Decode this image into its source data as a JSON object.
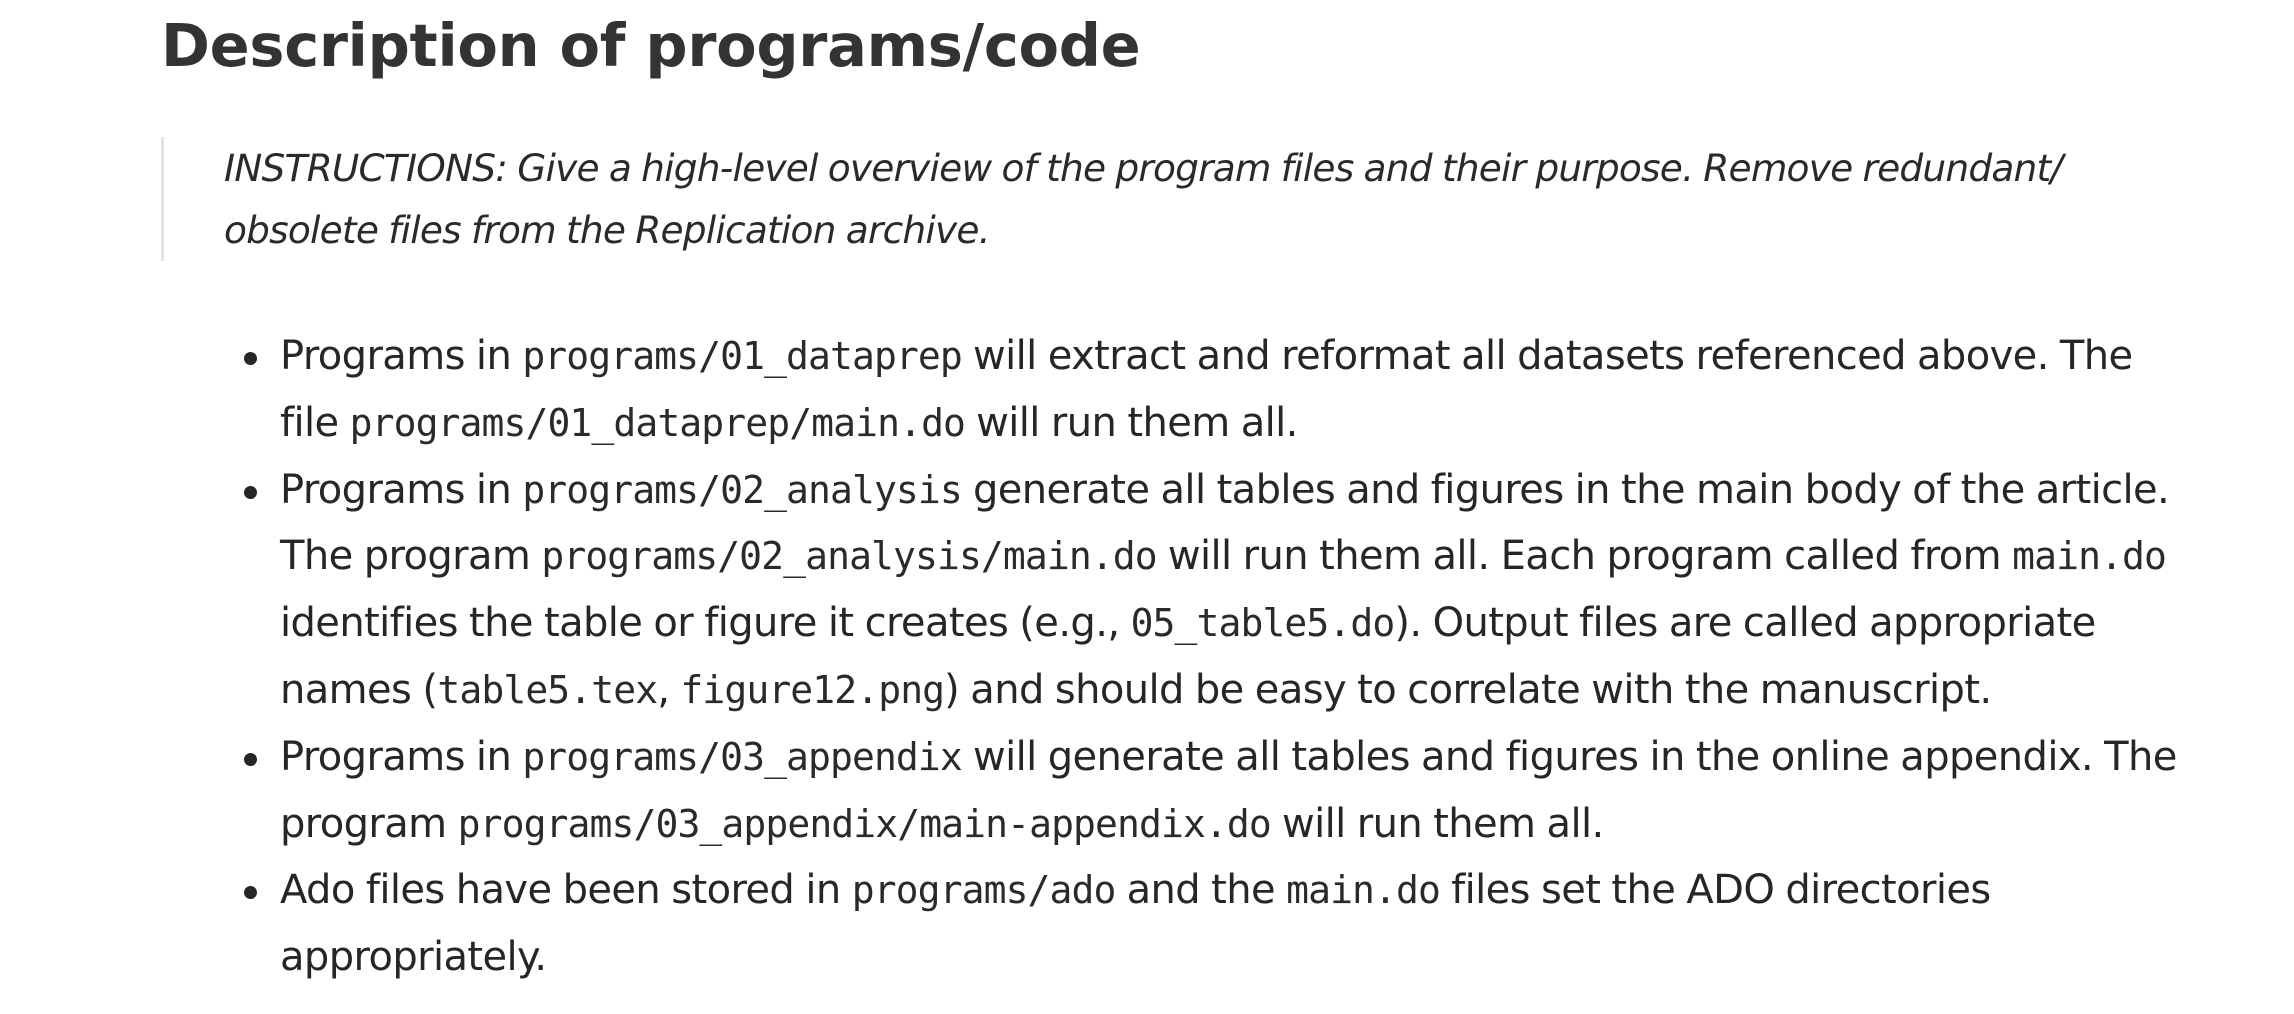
{
  "section": {
    "heading": "Description of programs/code",
    "instructions": "INSTRUCTIONS: Give a high-level overview of the program files and their purpose. Remove redundant/ obsolete files from the Replication archive."
  },
  "items": [
    {
      "t1": "Programs in ",
      "c1": "programs/01_dataprep",
      "t2": " will extract and reformat all datasets referenced above. The file ",
      "c2": "programs/01_dataprep/main.do",
      "t3": " will run them all."
    },
    {
      "t1": "Programs in ",
      "c1": "programs/02_analysis",
      "t2": " generate all tables and figures in the main body of the article. The program ",
      "c2": "programs/02_analysis/main.do",
      "t3": " will run them all. Each program called from ",
      "c3": "main.do",
      "t4": " identifies the table or figure it creates (e.g., ",
      "c4": "05_table5.do",
      "t5": "). Output files are called appropriate names (",
      "c5": "table5.tex",
      "t6": ", ",
      "c6": "figure12.png",
      "t7": ") and should be easy to correlate with the manuscript."
    },
    {
      "t1": "Programs in ",
      "c1": "programs/03_appendix",
      "t2": " will generate all tables and figures in the online appendix. The program ",
      "c2": "programs/03_appendix/main-appendix.do",
      "t3": " will run them all."
    },
    {
      "t1": "Ado files have been stored in ",
      "c1": "programs/ado",
      "t2": " and the ",
      "c2": "main.do",
      "t3": " files set the ADO directories appropriately."
    }
  ]
}
